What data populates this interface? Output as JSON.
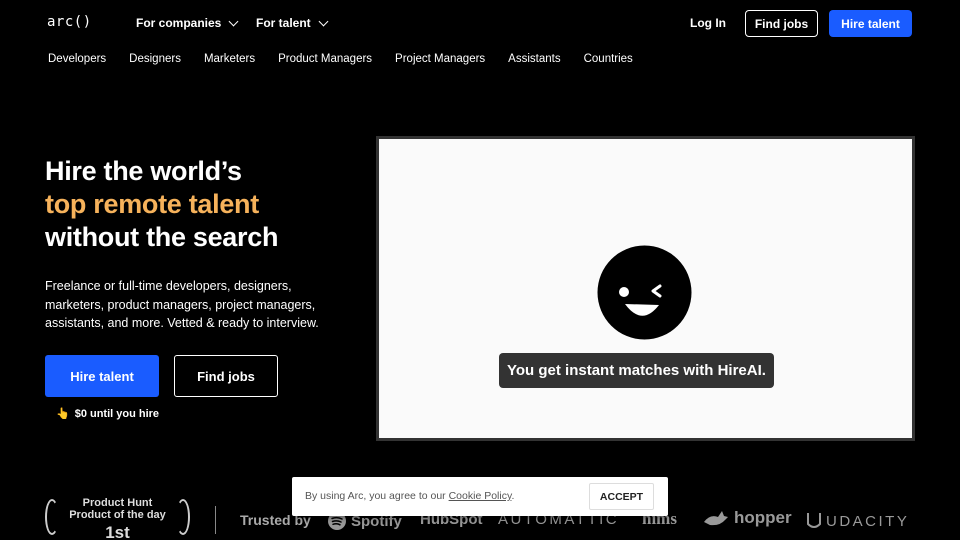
{
  "header": {
    "logo": "arc()",
    "nav": [
      {
        "label": "For companies"
      },
      {
        "label": "For talent"
      }
    ],
    "login": "Log In",
    "find_jobs": "Find jobs",
    "hire_talent": "Hire talent"
  },
  "subnav": [
    "Developers",
    "Designers",
    "Marketers",
    "Product Managers",
    "Project Managers",
    "Assistants",
    "Countries"
  ],
  "hero": {
    "title_line1": "Hire the world’s",
    "title_line2": "top remote talent",
    "title_line3": "without the search",
    "description": "Freelance or full-time developers, designers, marketers, product managers, project managers, assistants, and more. Vetted & ready to interview.",
    "hire_button": "Hire talent",
    "find_button": "Find jobs",
    "note_emoji": "👆",
    "note": "$0 until you hire"
  },
  "video": {
    "caption": "You get instant matches with HireAI."
  },
  "award": {
    "line1": "Product Hunt",
    "line2": "Product of the day",
    "rank": "1st"
  },
  "trusted": {
    "label": "Trusted by",
    "brands": [
      "Spotify",
      "HubSpot",
      "AUTOMATTIC",
      "hims",
      "hopper",
      "UDACITY"
    ]
  },
  "cookie": {
    "text": "By using Arc, you agree to our",
    "link": "Cookie Policy",
    "suffix": ".",
    "accept": "ACCEPT"
  },
  "colors": {
    "accent": "#f6b25b",
    "primary_blue": "#1a5cff",
    "background": "#000000"
  }
}
